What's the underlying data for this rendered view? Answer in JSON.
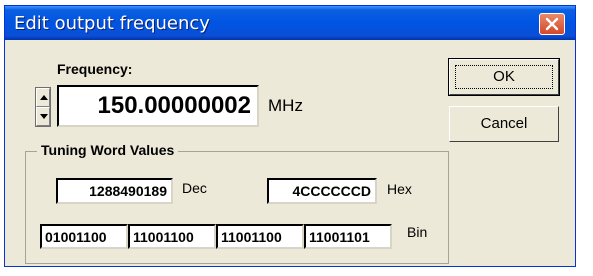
{
  "window": {
    "title": "Edit output frequency",
    "close_icon": "close-icon"
  },
  "frequency": {
    "label": "Frequency:",
    "value": "150.00000002",
    "unit": "MHz"
  },
  "buttons": {
    "ok_label": "OK",
    "cancel_label": "Cancel"
  },
  "tuning": {
    "group_label": "Tuning Word Values",
    "dec_value": "1288490189",
    "dec_label": "Dec",
    "hex_value": "4CCCCCCD",
    "hex_label": "Hex",
    "bin_values": [
      "01001100",
      "11001100",
      "11001100",
      "11001101"
    ],
    "bin_label": "Bin"
  },
  "colors": {
    "titlebar": "#0054e3",
    "dialog_bg": "#ece9d8",
    "close_button": "#d4472a"
  }
}
